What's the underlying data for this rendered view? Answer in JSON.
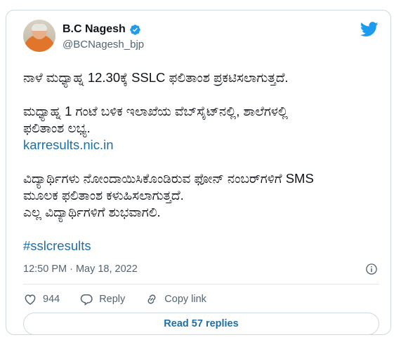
{
  "author": {
    "display_name": "B.C Nagesh",
    "handle": "@BCNagesh_bjp",
    "verified": true
  },
  "tweet": {
    "line1": "ನಾಳೆ ಮಧ್ಯಾಹ್ನ 12.30ಕ್ಕೆ SSLC ಫಲಿತಾಂಶ ಪ್ರಕಟಿಸಲಾಗುತ್ತದೆ.",
    "line2": "ಮಧ್ಯಾಹ್ನ 1 ಗಂಟೆ ಬಳಿಕ ಇಲಾಖೆಯ ವೆಬ್‌ಸೈಟ್‌ನಲ್ಲಿ, ಶಾಲೆಗಳಲ್ಲಿ",
    "line3": "ಫಲಿತಾಂಶ ಲಭ್ಯ.",
    "link": "karresults.nic.in",
    "line4": "ವಿದ್ಯಾರ್ಥಿಗಳು ನೋಂದಾಯಿಸಿಕೊಂಡಿರುವ ಫೋನ್ ನಂಬರ್‌ಗಳಿಗೆ SMS",
    "line5": "ಮೂಲಕ ಫಲಿತಾಂಶ ಕಳುಹಿಸಲಾಗುತ್ತದೆ.",
    "line6": "ಎಲ್ಲ ವಿದ್ಯಾರ್ಥಿಗಳಿಗೆ ಶುಭವಾಗಲಿ.",
    "hashtag": "#sslcresults"
  },
  "timestamp": "12:50 PM · May 18, 2022",
  "actions": {
    "like_count": "944",
    "reply_label": "Reply",
    "copy_label": "Copy link"
  },
  "read_replies_label": "Read 57 replies",
  "colors": {
    "accent": "#1d9bf0",
    "link": "#1d6fa8",
    "muted": "#536471",
    "like_red": "#e0245e"
  },
  "icons": [
    "twitter-bird-icon",
    "verified-badge-icon",
    "info-icon",
    "heart-icon",
    "reply-icon",
    "link-icon"
  ]
}
